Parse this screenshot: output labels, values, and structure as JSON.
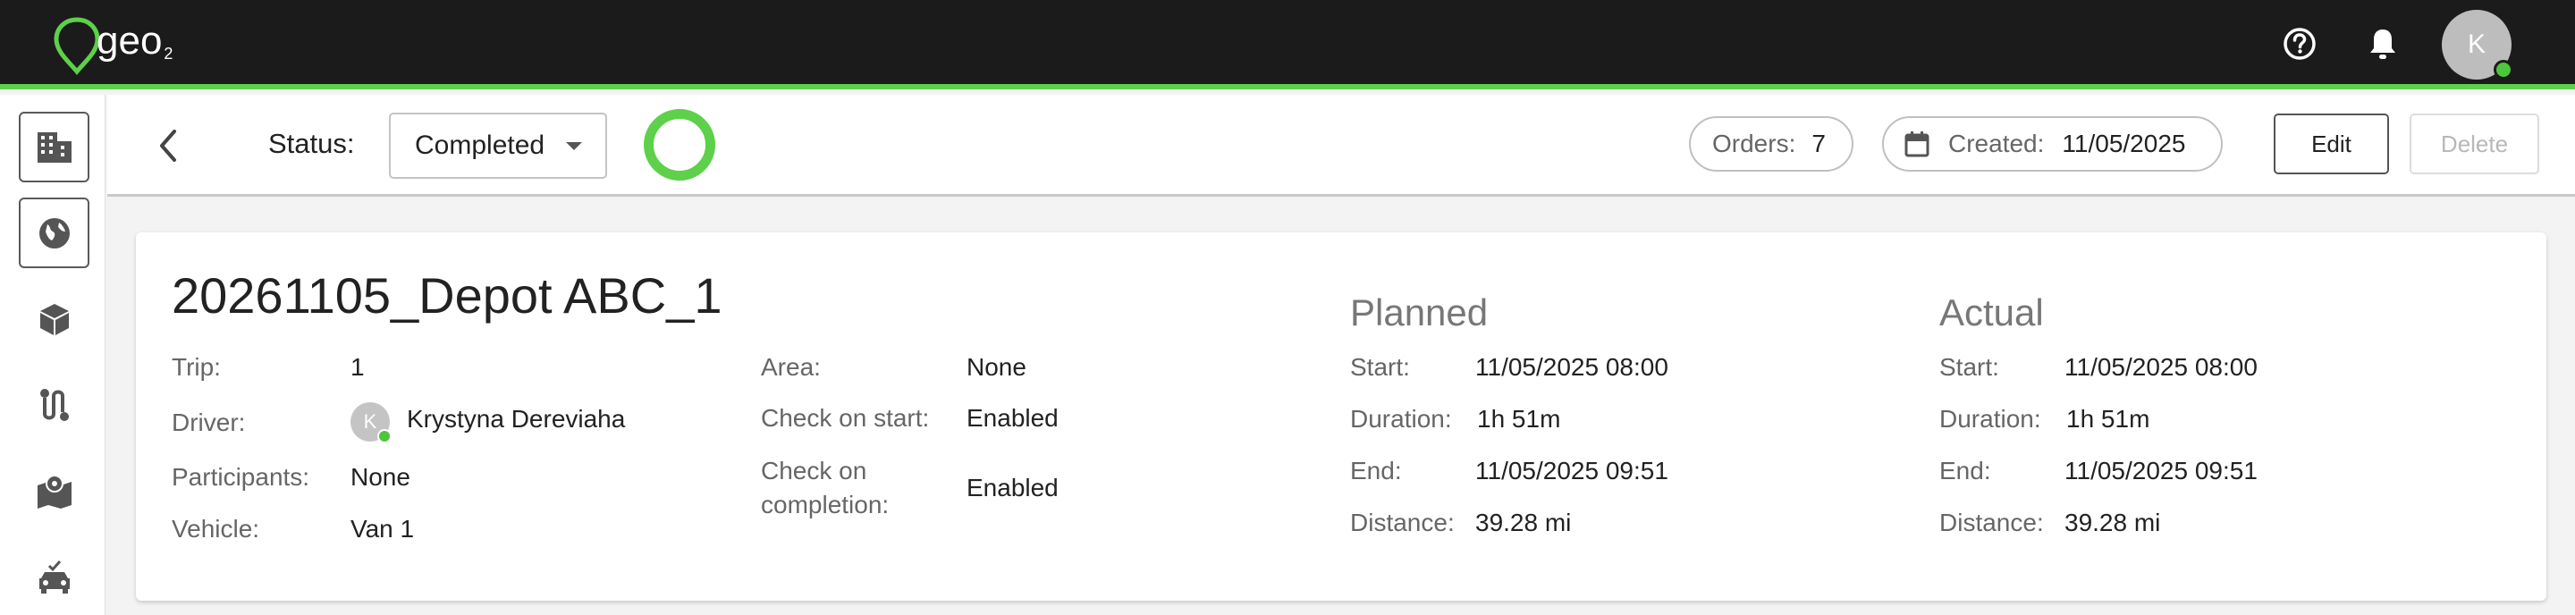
{
  "app": {
    "logo_text": "geo",
    "logo_sub": "2",
    "brand_color": "#5ed04a",
    "header_icons": [
      "help-icon",
      "bell-icon"
    ],
    "user_initial": "K"
  },
  "sidebar": {
    "items": [
      {
        "name": "sidebar-item-buildings",
        "icon": "building-icon"
      },
      {
        "name": "sidebar-item-globe",
        "icon": "globe-icon"
      },
      {
        "name": "sidebar-item-packages",
        "icon": "box-icon"
      },
      {
        "name": "sidebar-item-routes",
        "icon": "route-icon"
      },
      {
        "name": "sidebar-item-map",
        "icon": "map-icon"
      },
      {
        "name": "sidebar-item-vehicles",
        "icon": "car-check-icon"
      }
    ]
  },
  "toolbar": {
    "status_label": "Status:",
    "status_value": "Completed",
    "orders_label": "Orders:",
    "orders_value": "7",
    "created_label": "Created:",
    "created_value": "11/05/2025",
    "edit_label": "Edit",
    "delete_label": "Delete"
  },
  "trip": {
    "title": "20261105_Depot ABC_1",
    "left": {
      "trip_label": "Trip:",
      "trip_value": "1",
      "driver_label": "Driver:",
      "driver_initial": "K",
      "driver_value": "Krystyna Dereviaha",
      "participants_label": "Participants:",
      "participants_value": "None",
      "vehicle_label": "Vehicle:",
      "vehicle_value": "Van 1"
    },
    "middle": {
      "area_label": "Area:",
      "area_value": "None",
      "check_start_label": "Check on start:",
      "check_start_value": "Enabled",
      "check_completion_label_1": "Check on",
      "check_completion_label_2": "completion:",
      "check_completion_value": "Enabled"
    },
    "planned": {
      "title": "Planned",
      "start_label": "Start:",
      "start_value": "11/05/2025 08:00",
      "duration_label": "Duration:",
      "duration_value": "1h 51m",
      "end_label": "End:",
      "end_value": "11/05/2025 09:51",
      "distance_label": "Distance:",
      "distance_value": "39.28 mi"
    },
    "actual": {
      "title": "Actual",
      "start_label": "Start:",
      "start_value": "11/05/2025 08:00",
      "duration_label": "Duration:",
      "duration_value": "1h 51m",
      "end_label": "End:",
      "end_value": "11/05/2025 09:51",
      "distance_label": "Distance:",
      "distance_value": "39.28 mi"
    }
  }
}
